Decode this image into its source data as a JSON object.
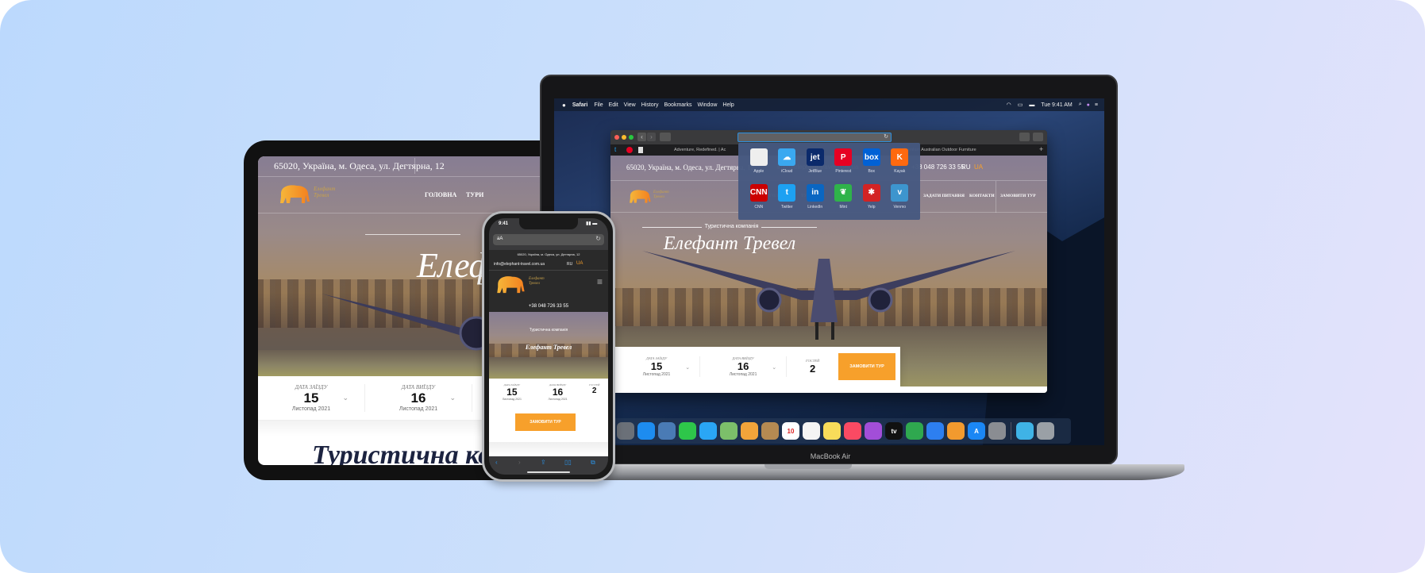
{
  "site": {
    "address": "65020, Україна, м. Одеса, ул. Дегтярна, 12",
    "email": "info@elephant-travel.com.ua",
    "phone": "+38 048 726 33 55",
    "lang_ru": "RU",
    "lang_ua": "UA",
    "logo_text": "Елефант Тревел",
    "nav": [
      "ГОЛОВНА",
      "ТУРИ",
      "ЗАДАТИ ПИТАННЯ",
      "КОНТАКТИ",
      "ЗАМОВИТИ ТУР"
    ],
    "hero_subtitle": "Туристична компанія",
    "hero_title": "Елефант Тревел",
    "booking": {
      "checkin_label": "Дата заїзду",
      "checkin_day": "15",
      "checkin_month": "Листопад 2021",
      "checkout_label": "Дата виїзду",
      "checkout_day": "16",
      "checkout_month": "Листопад 2021",
      "guests_label": "Гостей",
      "guests": "2",
      "submit": "ЗАМОВИТИ ТУР"
    },
    "section_title": "Туристична компанія",
    "accent_color": "#f7a02b"
  },
  "macos": {
    "app": "Safari",
    "menus": [
      "File",
      "Edit",
      "View",
      "History",
      "Bookmarks",
      "Window",
      "Help"
    ],
    "clock": "Tue 9:41 AM",
    "device_label": "MacBook Air"
  },
  "safari": {
    "tabs": [
      "Adventure, Redefined. | Ac",
      "Tait | Premium Australian Outdoor Furniture"
    ],
    "favorites": [
      {
        "name": "Apple",
        "glyph": "",
        "color": "#eeeeee"
      },
      {
        "name": "iCloud",
        "glyph": "☁",
        "color": "#3aa8f0"
      },
      {
        "name": "JetBlue",
        "glyph": "jet",
        "color": "#0b2a6b"
      },
      {
        "name": "Pinterest",
        "glyph": "P",
        "color": "#e60023"
      },
      {
        "name": "Box",
        "glyph": "box",
        "color": "#0061d5"
      },
      {
        "name": "Kayak",
        "glyph": "K",
        "color": "#ff690f"
      },
      {
        "name": "CNN",
        "glyph": "CNN",
        "color": "#cc0000"
      },
      {
        "name": "Twitter",
        "glyph": "t",
        "color": "#1da1f2"
      },
      {
        "name": "LinkedIn",
        "glyph": "in",
        "color": "#0a66c2"
      },
      {
        "name": "Mint",
        "glyph": "❦",
        "color": "#2fb34a"
      },
      {
        "name": "Yelp",
        "glyph": "✱",
        "color": "#d32323"
      },
      {
        "name": "Venmo",
        "glyph": "v",
        "color": "#3d95ce"
      }
    ]
  },
  "dock": [
    {
      "icon": "launchpad-icon",
      "color": "#6b7078"
    },
    {
      "icon": "safari-icon",
      "color": "#1d8cf0"
    },
    {
      "icon": "preview-icon",
      "color": "#4a7bb5"
    },
    {
      "icon": "facetime-icon",
      "color": "#2ec64a"
    },
    {
      "icon": "messages-icon",
      "color": "#2aa6f5"
    },
    {
      "icon": "maps-icon",
      "color": "#7cbf6a"
    },
    {
      "icon": "photos-icon",
      "color": "#f2a43a"
    },
    {
      "icon": "contacts-icon",
      "color": "#b58a52"
    },
    {
      "icon": "calendar-icon",
      "color": "#ffffff",
      "glyph": "10"
    },
    {
      "icon": "reminders-icon",
      "color": "#f4f4f4"
    },
    {
      "icon": "notes-icon",
      "color": "#f8dc5a"
    },
    {
      "icon": "music-icon",
      "color": "#fa4a63"
    },
    {
      "icon": "podcasts-icon",
      "color": "#a24ed8"
    },
    {
      "icon": "tv-icon",
      "color": "#111111",
      "glyph": "tv"
    },
    {
      "icon": "numbers-icon",
      "color": "#2fa84f"
    },
    {
      "icon": "keynote-icon",
      "color": "#2d7ff0"
    },
    {
      "icon": "pages-icon",
      "color": "#f29a2e"
    },
    {
      "icon": "app-store-icon",
      "color": "#1b87f5",
      "glyph": "A"
    },
    {
      "icon": "system-preferences-icon",
      "color": "#8a8d92"
    },
    {
      "icon": "folder-icon",
      "color": "#3fb3e6"
    },
    {
      "icon": "trash-icon",
      "color": "#9aa0a6"
    }
  ],
  "phone": {
    "time": "9:41",
    "url": "aA"
  }
}
